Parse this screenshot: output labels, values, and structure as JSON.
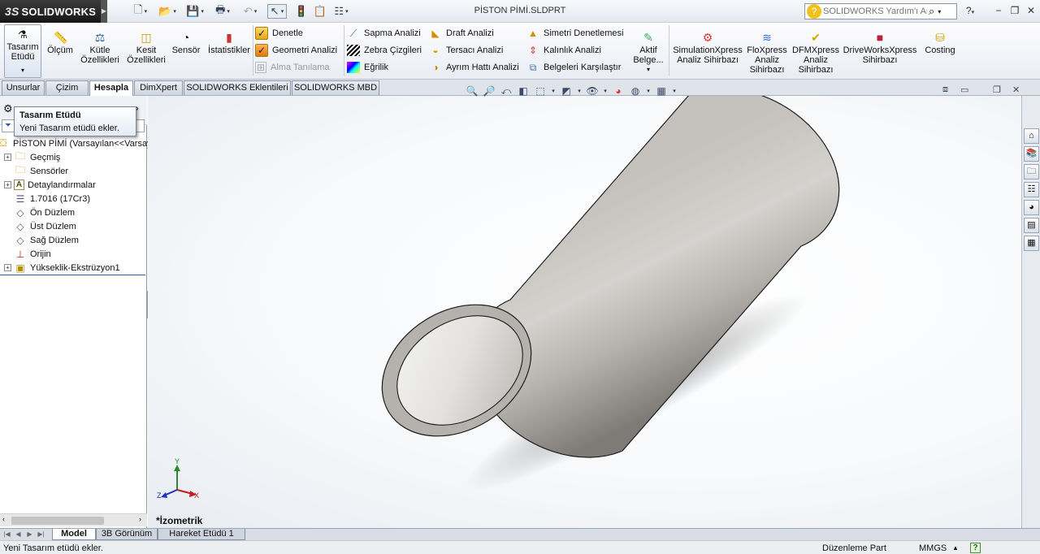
{
  "app": {
    "brand_prefix": "3S",
    "brand": "SOLIDWORKS"
  },
  "window": {
    "title": "PİSTON PİMİ.SLDPRT"
  },
  "search": {
    "placeholder": "SOLIDWORKS Yardım'ı Ara",
    "help_mark": "?"
  },
  "ribbon": {
    "design_study": "Tasarım Etüdü",
    "measure": "Ölçüm",
    "mass_properties": "Kütle Özellikleri",
    "section_properties": "Kesit Özellikleri",
    "sensor": "Sensör",
    "statistics": "İstatistikler",
    "check": "Denetle",
    "geometry_analysis": "Geometri Analizi",
    "import_diagnostics": "Alma Tanılama",
    "deviation_analysis": "Sapma Analizi",
    "zebra_stripes": "Zebra Çizgileri",
    "curvature": "Eğrilik",
    "draft_analysis": "Draft Analizi",
    "undercut_analysis": "Tersacı Analizi",
    "parting_line_analysis": "Ayrım Hattı Analizi",
    "symmetry_check": "Simetri Denetlemesi",
    "thickness_analysis": "Kalınlık Analizi",
    "compare_documents": "Belgeleri  Karşılaştır",
    "active_document": "Aktif Belge...",
    "simulationxpress": "SimulationXpress Analiz Sihirbazı",
    "floxpress": "FloXpress Analiz Sihirbazı",
    "dfmxpress": "DFMXpress Analiz Sihirbazı",
    "driveworksxpress": "DriveWorksXpress Sihirbazı",
    "costing": "Costing"
  },
  "tabs": [
    {
      "label": "Unsurlar"
    },
    {
      "label": "Çizim"
    },
    {
      "label": "Hesapla"
    },
    {
      "label": "DimXpert"
    },
    {
      "label": "SOLIDWORKS Eklentileri"
    },
    {
      "label": "SOLIDWORKS MBD"
    }
  ],
  "tooltip": {
    "title": "Tasarım Etüdü",
    "body": "Yeni Tasarım etüdü ekler."
  },
  "tree": {
    "root": "PİSTON PİMİ  (Varsayılan<<Varsayılan",
    "items": [
      {
        "label": "Geçmiş"
      },
      {
        "label": "Sensörler"
      },
      {
        "label": "Detaylandırmalar"
      },
      {
        "label": "1.7016 (17Cr3)"
      },
      {
        "label": "Ön Düzlem"
      },
      {
        "label": "Üst Düzlem"
      },
      {
        "label": "Sağ Düzlem"
      },
      {
        "label": "Orijin"
      },
      {
        "label": "Yükseklik-Ekstrüzyon1"
      }
    ]
  },
  "viewport": {
    "view_name": "*İzometrik"
  },
  "triad": {
    "x": "X",
    "y": "Y",
    "z": "Z"
  },
  "bottom_tabs": [
    {
      "label": "Model"
    },
    {
      "label": "3B Görünüm"
    },
    {
      "label": "Hareket Etüdü 1"
    }
  ],
  "status": {
    "message": "Yeni Tasarım etüdü ekler.",
    "mode": "Düzenleme Part",
    "units": "MMGS",
    "units_arrow": "▲"
  },
  "colors": {
    "part_body": "#c8c6c2",
    "accent": "#f2c21c",
    "brand_bg": "#1e1e1e"
  }
}
